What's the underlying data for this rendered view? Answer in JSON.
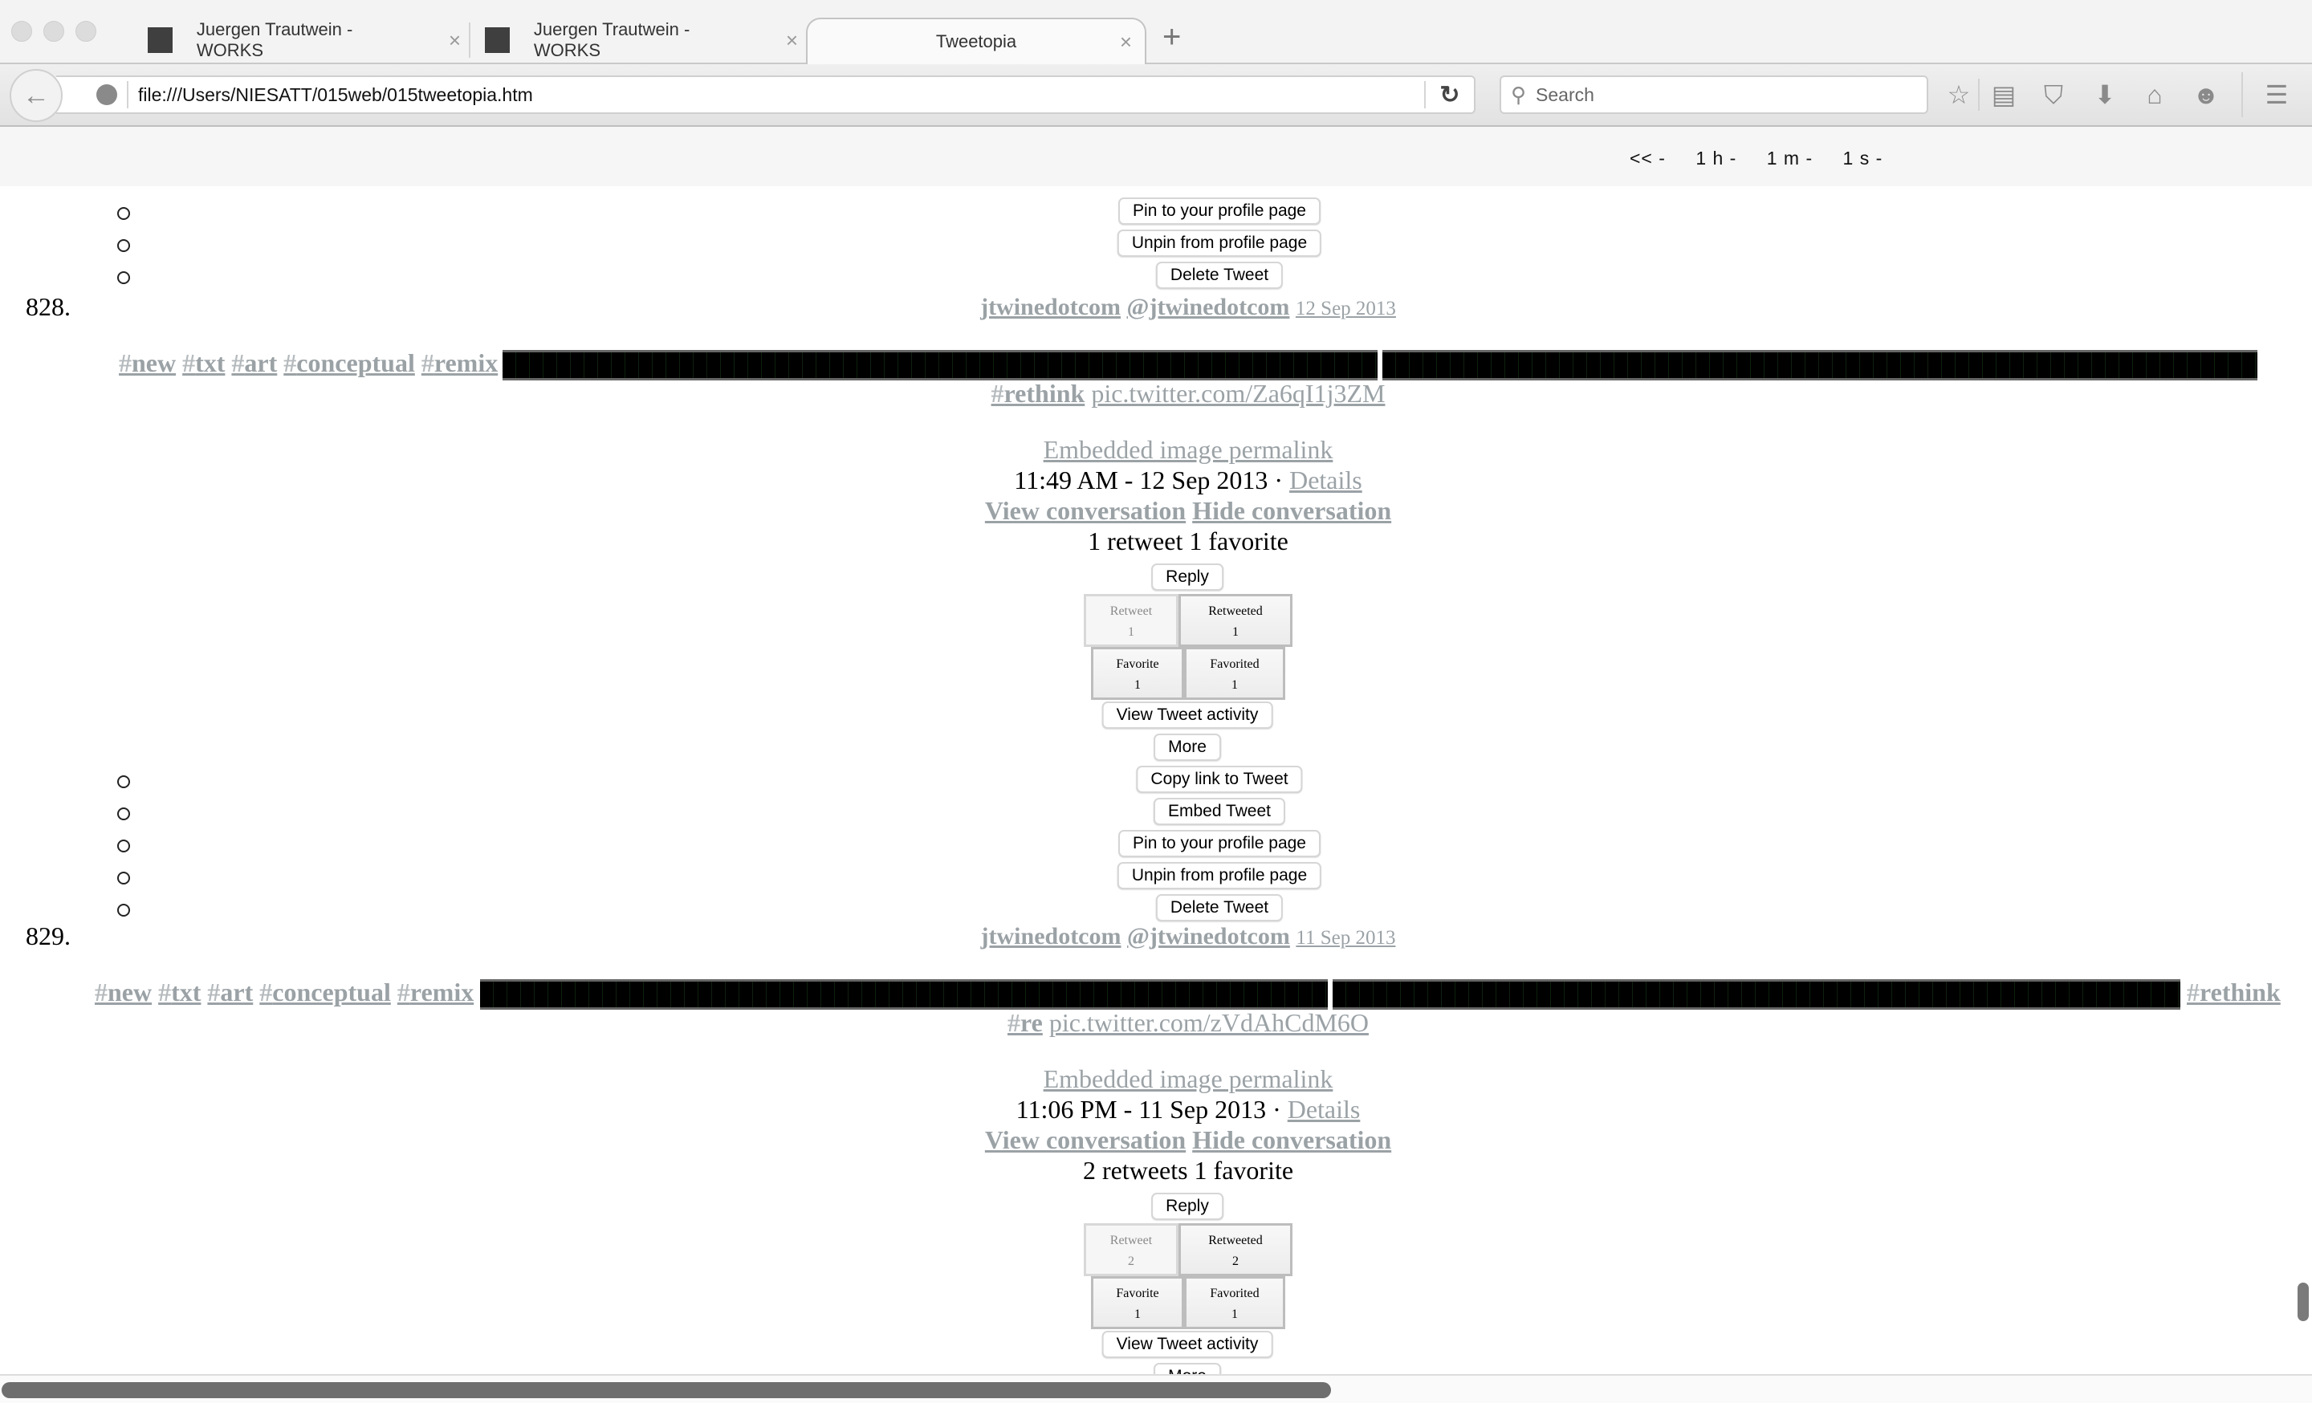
{
  "browser": {
    "tabs": [
      {
        "label": "Juergen Trautwein - WORKS",
        "active": false
      },
      {
        "label": "Juergen Trautwein - WORKS",
        "active": false
      },
      {
        "label": "Tweetopia",
        "active": true
      }
    ],
    "new_tab_label": "+",
    "close_glyph": "×",
    "url": "file:///Users/NIESATT/015web/015tweetopia.htm",
    "search_placeholder": "Search",
    "icons": [
      "back-arrow-icon",
      "globe-icon",
      "reload-icon",
      "search-icon",
      "bookmark-star-icon",
      "reading-list-icon",
      "pocket-icon",
      "download-icon",
      "home-icon",
      "hello-chat-icon",
      "menu-icon"
    ]
  },
  "time_nav": {
    "items": [
      "<< -",
      "1 h -",
      "1 m -",
      "1 s -"
    ]
  },
  "top_menu": {
    "items": [
      "Pin to your profile page",
      "Unpin from profile page",
      "Delete Tweet"
    ]
  },
  "tweets": [
    {
      "number": "828.",
      "user_name": "jtwinedotcom",
      "handle": "@jtwinedotcom",
      "date": "12 Sep 2013",
      "hashtags": [
        "new",
        "txt",
        "art",
        "conceptual",
        "remix"
      ],
      "trailing_hashtags": [
        "rethink"
      ],
      "pic_link": "pic.twitter.com/Za6qI1j3ZM",
      "permalink": "Embedded image permalink",
      "timestamp": "11:49 AM - 12 Sep 2013 ·",
      "details": "Details",
      "view_conversation": "View conversation",
      "hide_conversation": "Hide conversation",
      "stats": "1 retweet 1 favorite",
      "reply": "Reply",
      "retweet": {
        "label": "Retweet",
        "count": "1"
      },
      "retweeted": {
        "label": "Retweeted",
        "count": "1"
      },
      "favorite": {
        "label": "Favorite",
        "count": "1"
      },
      "favorited": {
        "label": "Favorited",
        "count": "1"
      },
      "activity": "View Tweet activity",
      "more": "More",
      "more_menu": [
        "Copy link to Tweet",
        "Embed Tweet",
        "Pin to your profile page",
        "Unpin from profile page",
        "Delete Tweet"
      ]
    },
    {
      "number": "829.",
      "user_name": "jtwinedotcom",
      "handle": "@jtwinedotcom",
      "date": "11 Sep 2013",
      "hashtags": [
        "new",
        "txt",
        "art",
        "conceptual",
        "remix"
      ],
      "trailing_hashtags": [
        "rethink",
        "re"
      ],
      "pic_link": "pic.twitter.com/zVdAhCdM6O",
      "permalink": "Embedded image permalink",
      "timestamp": "11:06 PM - 11 Sep 2013 ·",
      "details": "Details",
      "view_conversation": "View conversation",
      "hide_conversation": "Hide conversation",
      "stats": "2 retweets 1 favorite",
      "reply": "Reply",
      "retweet": {
        "label": "Retweet",
        "count": "2"
      },
      "retweeted": {
        "label": "Retweeted",
        "count": "2"
      },
      "favorite": {
        "label": "Favorite",
        "count": "1"
      },
      "favorited": {
        "label": "Favorited",
        "count": "1"
      },
      "activity": "View Tweet activity",
      "more": "More"
    }
  ],
  "hash_symbol": "#"
}
